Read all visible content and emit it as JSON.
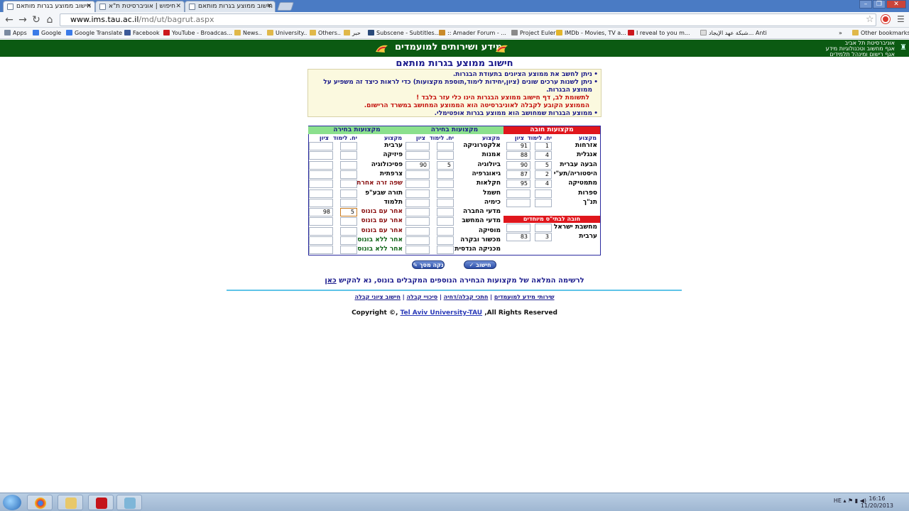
{
  "browser": {
    "tabs": [
      {
        "label": "חישוב ממוצע בגרות מותאם",
        "active": true
      },
      {
        "label": "חיפוש | אוניברסיטת ת\"א",
        "active": false
      },
      {
        "label": "חישוב ממוצע בגרות מותאם",
        "active": false
      }
    ],
    "url_host": "www.ims.tau.ac.il",
    "url_path": "/md/ut/bagrut.aspx",
    "bookmarks": [
      "Apps",
      "Google",
      "Google Translate",
      "Facebook",
      "YouTube - Broadcas...",
      "News..",
      "University..",
      "Others..",
      "حبر",
      "Subscene - Subtitles...",
      ":: Amader Forum - ...",
      "Project Euler",
      "IMDb - Movies, TV a...",
      "I reveal to you m...",
      "شبكة عهد الإيجاد... Anti",
      "Other bookmarks"
    ]
  },
  "banner": {
    "title": "מידע ושירותים למועמדים",
    "university": [
      "אוניברסיטת תל אביב",
      "אגף מחשוב וטכנולוגיות מידע",
      "אגף רישום ומינהל תלמידים"
    ]
  },
  "page_title": "חישוב ממוצע בגרות מותאם",
  "notes": {
    "n1": "ניתן לחשב את ממוצע הציונים בתעודת הבגרות.",
    "n2": "ניתן לשנות ערכים שונים (ציון,יחידות לימוד,תוספת מקצועות) כדי לראות כיצד זה משפיע על ממוצע הבגרות.",
    "n3": "לתשומת לב, דף חישוב ממוצע הבגרות הינו כלי עזר בלבד !",
    "n4": "הממוצע הקובע לקבלה לאוניברסיטה הוא הממוצע המחושב במשרד הרישום.",
    "n5": "ממוצע הבגרות שמחושב הוא ממוצע בגרות אופטימלי."
  },
  "table": {
    "col_subject": "מקצוע",
    "col_units": "יח. לימוד",
    "col_grade": "ציון",
    "mandatory": {
      "title": "מקצועות חובה",
      "rows": [
        {
          "subject": "אזרחות",
          "units": "1",
          "grade": "91"
        },
        {
          "subject": "אנגלית",
          "units": "4",
          "grade": "88"
        },
        {
          "subject": "הבעה עברית",
          "units": "5",
          "grade": "90"
        },
        {
          "subject": "היסטוריה/תע\"י",
          "units": "2",
          "grade": "87"
        },
        {
          "subject": "מתמטיקה",
          "units": "4",
          "grade": "95"
        },
        {
          "subject": "ספרות",
          "units": "",
          "grade": ""
        },
        {
          "subject": "תנ\"ך",
          "units": "",
          "grade": ""
        }
      ],
      "special_title": "חובה לבתי\"ס מיוחדים",
      "special_rows": [
        {
          "subject": "מחשבת ישראל",
          "units": "",
          "grade": ""
        },
        {
          "subject": "ערבית",
          "units": "3",
          "grade": "83"
        }
      ]
    },
    "elective1": {
      "title": "מקצועות בחירה",
      "rows": [
        {
          "subject": "אלקטרוניקה",
          "units": "",
          "grade": ""
        },
        {
          "subject": "אמנות",
          "units": "",
          "grade": ""
        },
        {
          "subject": "ביולוגיה",
          "units": "5",
          "grade": "90"
        },
        {
          "subject": "גיאוגרפיה",
          "units": "",
          "grade": ""
        },
        {
          "subject": "חקלאות",
          "units": "",
          "grade": ""
        },
        {
          "subject": "חשמל",
          "units": "",
          "grade": ""
        },
        {
          "subject": "כימיה",
          "units": "",
          "grade": ""
        },
        {
          "subject": "מדעי החברה",
          "units": "",
          "grade": ""
        },
        {
          "subject": "מדעי המחשב",
          "units": "",
          "grade": ""
        },
        {
          "subject": "מוסיקה",
          "units": "",
          "grade": ""
        },
        {
          "subject": "מכשור ובקרה",
          "units": "",
          "grade": ""
        },
        {
          "subject": "מכניקה הנדסית",
          "units": "",
          "grade": ""
        }
      ]
    },
    "elective2": {
      "title": "מקצועות בחירה",
      "rows": [
        {
          "subject": "ערבית",
          "units": "",
          "grade": ""
        },
        {
          "subject": "פיזיקה",
          "units": "",
          "grade": ""
        },
        {
          "subject": "פסיכולוגיה",
          "units": "",
          "grade": ""
        },
        {
          "subject": "צרפתית",
          "units": "",
          "grade": ""
        },
        {
          "subject": "שפה זרה אחרת",
          "units": "",
          "grade": ""
        },
        {
          "subject": "תורה שבע\"פ",
          "units": "",
          "grade": ""
        },
        {
          "subject": "תלמוד",
          "units": "",
          "grade": ""
        },
        {
          "subject": "אחר עם בונוס",
          "units": "5",
          "grade": "98"
        },
        {
          "subject": "אחר עם בונוס",
          "units": "",
          "grade": ""
        },
        {
          "subject": "אחר עם בונוס",
          "units": "",
          "grade": ""
        },
        {
          "subject": "אחר ללא בונוס",
          "units": "",
          "grade": ""
        },
        {
          "subject": "אחר ללא בונוס",
          "units": "",
          "grade": ""
        }
      ]
    }
  },
  "buttons": {
    "calc": "חישוב",
    "clear": "נקה מסך"
  },
  "full_list": {
    "text": "לרשימה המלאה של מקצועות הבחירה הנוספים המקבלים בונוס, נא להקיש",
    "link": "כאן"
  },
  "footer_links": [
    "שירותי מידע למועמדים",
    "חתכי קבלה/דחיה",
    "סיכויי קבלה",
    "חישוב ציוני קבלה"
  ],
  "copyright": {
    "prefix": "Copyright ©,",
    "link": "Tel Aviv University-TAU",
    "suffix": ",All Rights Reserved"
  },
  "taskbar": {
    "lang": "HE",
    "time": "16:16",
    "date": "11/20/2013"
  }
}
